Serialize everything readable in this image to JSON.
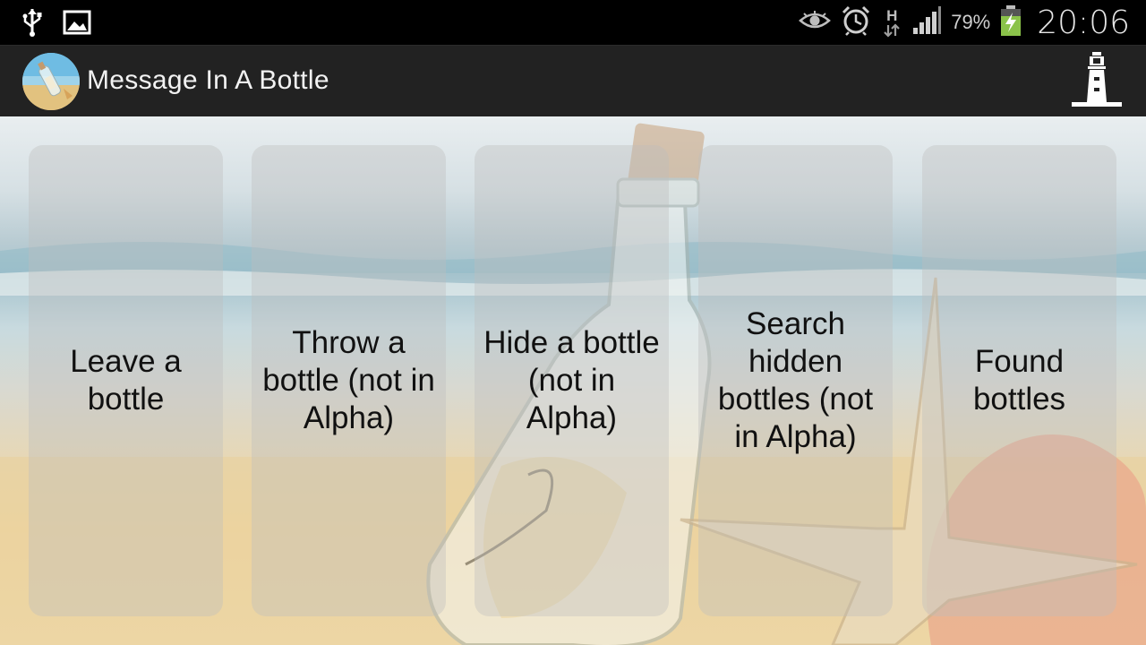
{
  "status_bar": {
    "left_icons": [
      "usb-icon",
      "image-icon"
    ],
    "right_icons": [
      "eye-icon",
      "alarm-icon",
      "hspa-data-icon",
      "signal-icon",
      "battery-charging-icon"
    ],
    "network_type": "H",
    "battery_percent": "79%",
    "time": "20:06"
  },
  "action_bar": {
    "title": "Message In A Bottle",
    "logo_icon": "message-bottle-logo",
    "right_icon": "lighthouse-icon"
  },
  "menu": {
    "items": [
      {
        "label": "Leave a bottle",
        "enabled": true
      },
      {
        "label": "Throw a bottle (not in Alpha)",
        "enabled": true
      },
      {
        "label": "Hide a bottle (not in Alpha)",
        "enabled": true
      },
      {
        "label": "Search hidden bottles (not in Alpha)",
        "enabled": true
      },
      {
        "label": "Found bottles",
        "enabled": true
      }
    ]
  },
  "colors": {
    "status_bar_bg": "#000000",
    "action_bar_bg": "#222222",
    "panel_bg": "rgba(190,190,190,0.38)",
    "battery_fill": "#8bc34a"
  }
}
